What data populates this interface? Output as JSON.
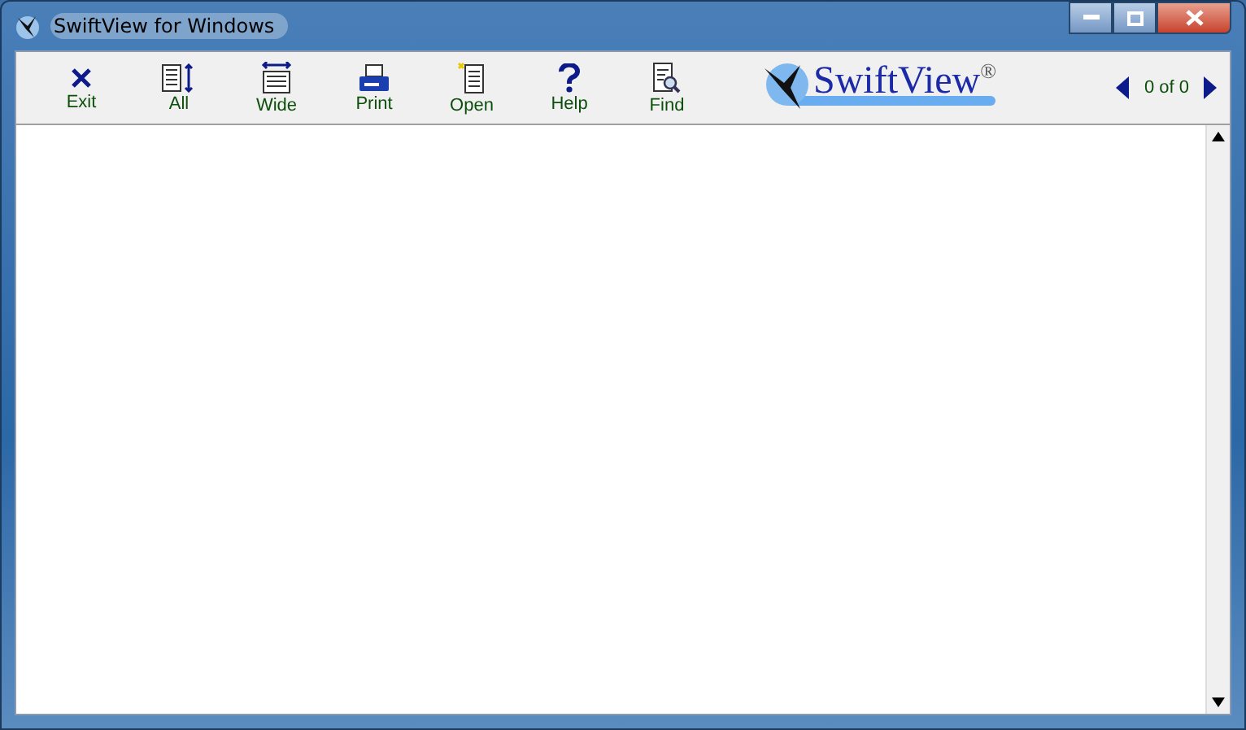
{
  "window": {
    "title": "SwiftView for Windows"
  },
  "toolbar": [
    {
      "kind": "exit",
      "label": "Exit"
    },
    {
      "kind": "all",
      "label": "All"
    },
    {
      "kind": "wide",
      "label": "Wide"
    },
    {
      "kind": "print",
      "label": "Print"
    },
    {
      "kind": "open",
      "label": "Open"
    },
    {
      "kind": "help",
      "label": "Help"
    },
    {
      "kind": "find",
      "label": "Find"
    }
  ],
  "logo": {
    "text": "SwiftView$^{®}$"
  },
  "pager": {
    "text": "0 of 0"
  }
}
